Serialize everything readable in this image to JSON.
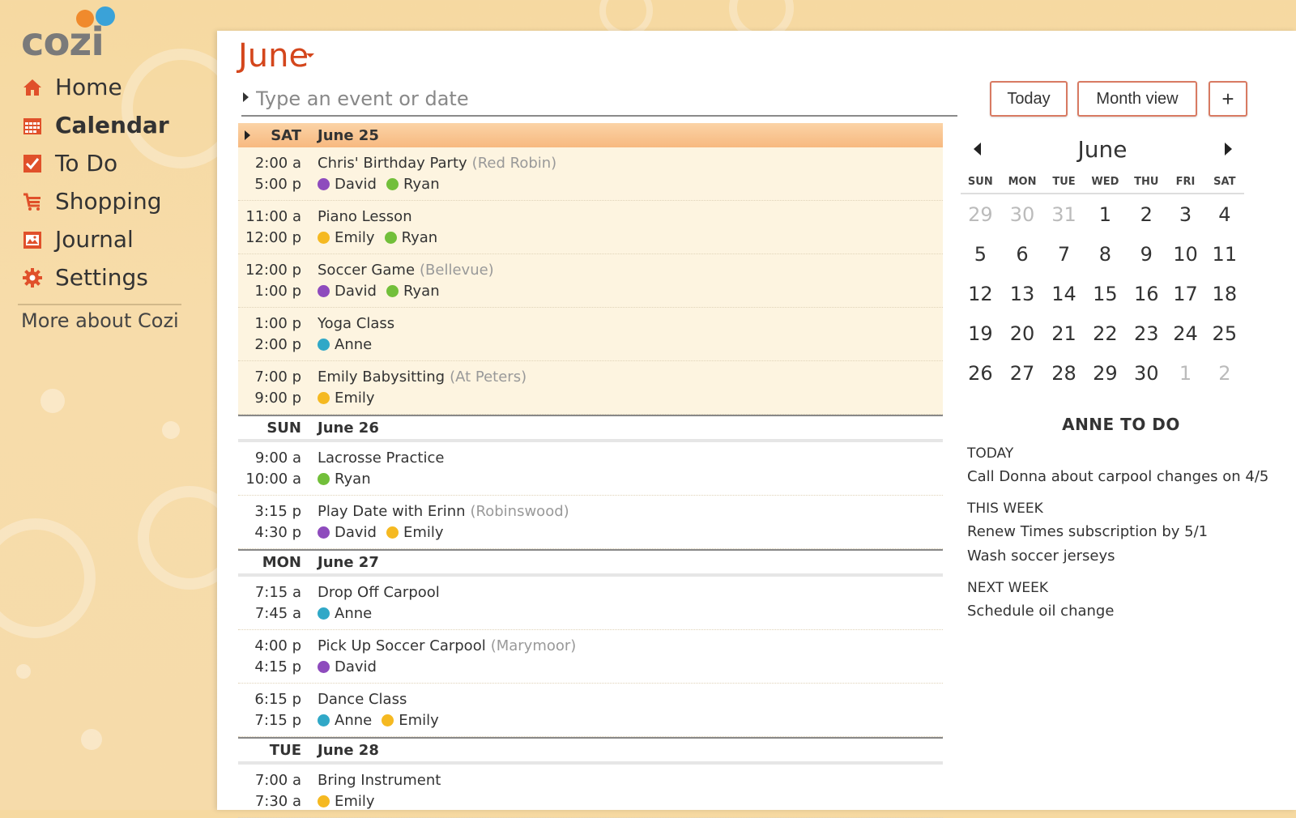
{
  "app": {
    "logo_text": "cozi"
  },
  "nav": {
    "items": [
      {
        "label": "Home",
        "icon": "home-icon"
      },
      {
        "label": "Calendar",
        "icon": "calendar-icon",
        "active": true
      },
      {
        "label": "To Do",
        "icon": "todo-icon"
      },
      {
        "label": "Shopping",
        "icon": "shopping-cart-icon"
      },
      {
        "label": "Journal",
        "icon": "journal-icon"
      },
      {
        "label": "Settings",
        "icon": "gear-icon"
      }
    ],
    "more": "More about Cozi"
  },
  "header": {
    "month": "June",
    "event_placeholder": "Type an event or date",
    "today_label": "Today",
    "month_view_label": "Month view",
    "add_label": "+"
  },
  "colors": {
    "accent": "#d4461c",
    "David": "#8e4bbd",
    "Ryan": "#72bf3a",
    "Emily": "#f5b921",
    "Anne": "#30a8c7"
  },
  "agenda": [
    {
      "dow": "SAT",
      "date": "June 25",
      "highlight": true,
      "events": [
        {
          "start": "2:00 a",
          "end": "5:00 p",
          "title": "Chris' Birthday Party",
          "loc": "(Red Robin)",
          "people": [
            "David",
            "Ryan"
          ]
        },
        {
          "start": "11:00 a",
          "end": "12:00 p",
          "title": "Piano Lesson",
          "loc": "",
          "people": [
            "Emily",
            "Ryan"
          ]
        },
        {
          "start": "12:00 p",
          "end": "1:00 p",
          "title": "Soccer Game",
          "loc": "(Bellevue)",
          "people": [
            "David",
            "Ryan"
          ]
        },
        {
          "start": "1:00 p",
          "end": "2:00 p",
          "title": "Yoga Class",
          "loc": "",
          "people": [
            "Anne"
          ]
        },
        {
          "start": "7:00 p",
          "end": "9:00 p",
          "title": "Emily Babysitting",
          "loc": "(At Peters)",
          "people": [
            "Emily"
          ]
        }
      ]
    },
    {
      "dow": "SUN",
      "date": "June 26",
      "highlight": false,
      "events": [
        {
          "start": "9:00 a",
          "end": "10:00 a",
          "title": "Lacrosse Practice",
          "loc": "",
          "people": [
            "Ryan"
          ]
        },
        {
          "start": "3:15 p",
          "end": "4:30 p",
          "title": "Play Date with Erinn",
          "loc": "(Robinswood)",
          "people": [
            "David",
            "Emily"
          ]
        }
      ]
    },
    {
      "dow": "MON",
      "date": "June 27",
      "highlight": false,
      "events": [
        {
          "start": "7:15 a",
          "end": "7:45 a",
          "title": "Drop Off Carpool",
          "loc": "",
          "people": [
            "Anne"
          ]
        },
        {
          "start": "4:00 p",
          "end": "4:15 p",
          "title": "Pick Up Soccer Carpool",
          "loc": "(Marymoor)",
          "people": [
            "David"
          ]
        },
        {
          "start": "6:15 p",
          "end": "7:15 p",
          "title": "Dance Class",
          "loc": "",
          "people": [
            "Anne",
            "Emily"
          ]
        }
      ]
    },
    {
      "dow": "TUE",
      "date": "June 28",
      "highlight": false,
      "events": [
        {
          "start": "7:00 a",
          "end": "7:30 a",
          "title": "Bring Instrument",
          "loc": "",
          "people": [
            "Emily"
          ]
        }
      ]
    }
  ],
  "mini_calendar": {
    "month": "June",
    "weekdays": [
      "SUN",
      "MON",
      "TUE",
      "WED",
      "THU",
      "FRI",
      "SAT"
    ],
    "weeks": [
      [
        {
          "d": "29",
          "dim": true
        },
        {
          "d": "30",
          "dim": true
        },
        {
          "d": "31",
          "dim": true
        },
        {
          "d": "1"
        },
        {
          "d": "2"
        },
        {
          "d": "3"
        },
        {
          "d": "4"
        }
      ],
      [
        {
          "d": "5"
        },
        {
          "d": "6"
        },
        {
          "d": "7"
        },
        {
          "d": "8"
        },
        {
          "d": "9"
        },
        {
          "d": "10"
        },
        {
          "d": "11"
        }
      ],
      [
        {
          "d": "12"
        },
        {
          "d": "13"
        },
        {
          "d": "14"
        },
        {
          "d": "15"
        },
        {
          "d": "16"
        },
        {
          "d": "17"
        },
        {
          "d": "18"
        }
      ],
      [
        {
          "d": "19"
        },
        {
          "d": "20"
        },
        {
          "d": "21"
        },
        {
          "d": "22"
        },
        {
          "d": "23"
        },
        {
          "d": "24"
        },
        {
          "d": "25"
        }
      ],
      [
        {
          "d": "26"
        },
        {
          "d": "27"
        },
        {
          "d": "28"
        },
        {
          "d": "29"
        },
        {
          "d": "30"
        },
        {
          "d": "1",
          "dim": true
        },
        {
          "d": "2",
          "dim": true
        }
      ]
    ]
  },
  "todo": {
    "title": "ANNE TO DO",
    "sections": [
      {
        "label": "TODAY",
        "items": [
          "Call Donna about carpool changes on 4/5"
        ]
      },
      {
        "label": "THIS WEEK",
        "items": [
          "Renew Times subscription by 5/1",
          "Wash soccer jerseys"
        ]
      },
      {
        "label": "NEXT WEEK",
        "items": [
          "Schedule oil change"
        ]
      }
    ]
  }
}
